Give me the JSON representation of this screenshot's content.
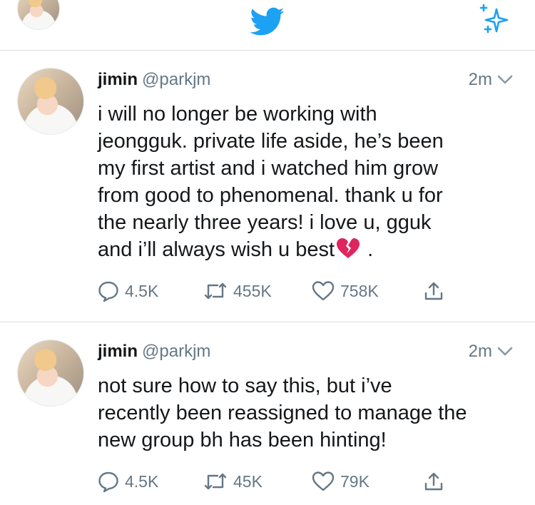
{
  "topbar": {
    "profile_icon": "profile-avatar",
    "logo_icon": "twitter-bird-icon",
    "compose_icon": "sparkle-icon"
  },
  "tweets": [
    {
      "name": "jimin",
      "handle": "@parkjm",
      "time": "2m",
      "text_line1": "i will no longer be working with",
      "text_line2": "jeongguk. private life aside, he’s been",
      "text_line3": "my first artist and i watched him grow",
      "text_line4": "from good to phenomenal. thank u for",
      "text_line5": "the nearly three years! i love u, gguk",
      "text_line6_before": "and i’ll always wish u best",
      "text_line6_after": " .",
      "emoji": "broken-heart-emoji",
      "replies": "4.5K",
      "retweets": "455K",
      "likes": "758K"
    },
    {
      "name": "jimin",
      "handle": "@parkjm",
      "time": "2m",
      "text_line1": "not sure how to say this, but i’ve",
      "text_line2": "recently been reassigned to manage the",
      "text_line3": "new group bh has been hinting!",
      "replies": "4.5K",
      "retweets": "45K",
      "likes": "79K"
    }
  ],
  "colors": {
    "twitter_blue": "#1da1f2",
    "text": "#14171a",
    "muted": "#657786",
    "divider": "#d8dde1",
    "heart_red": "#e0245e"
  }
}
